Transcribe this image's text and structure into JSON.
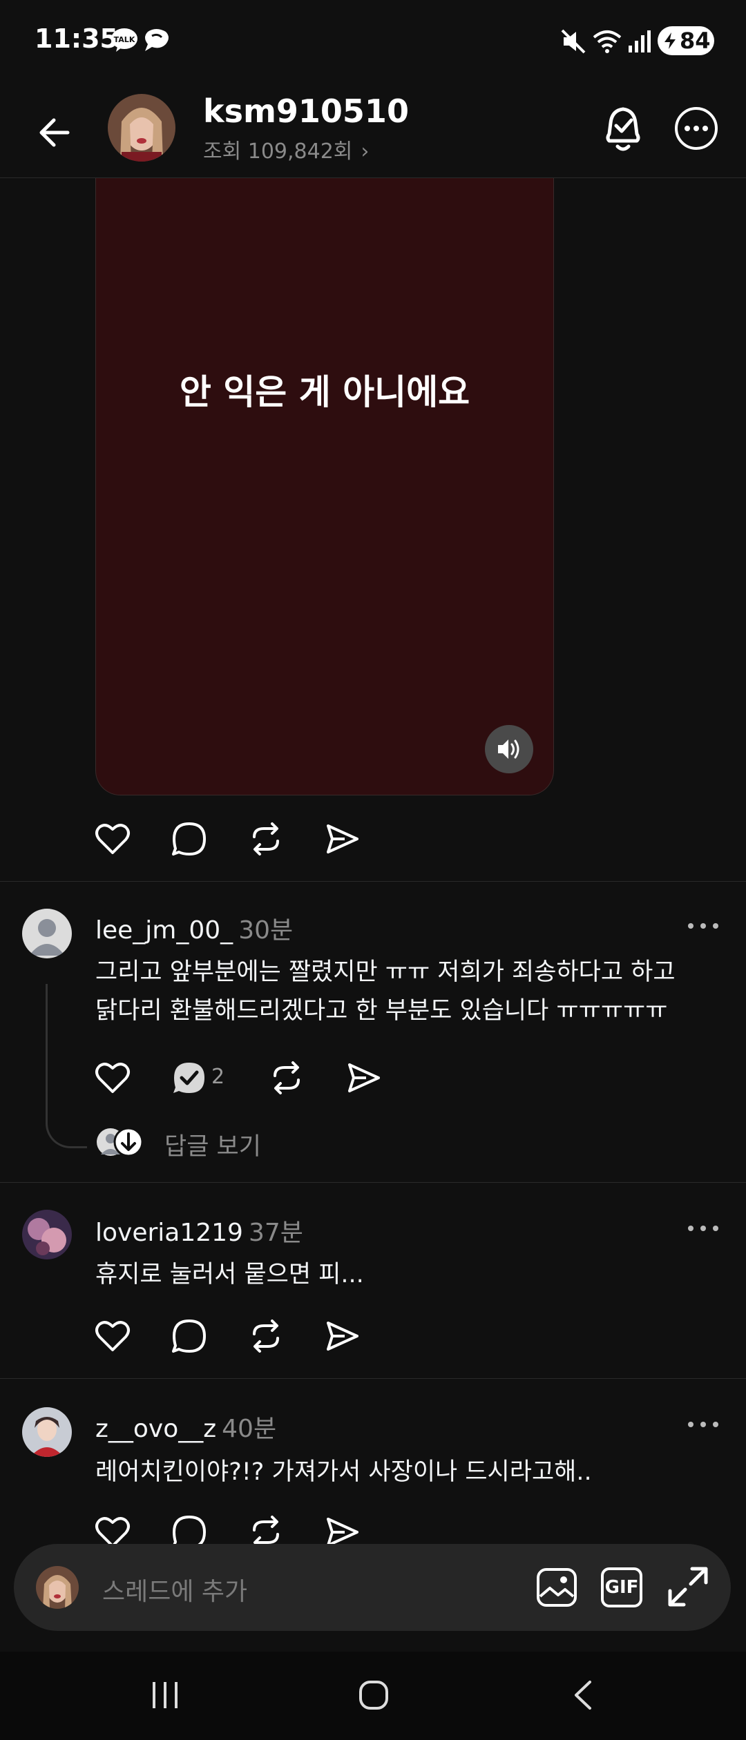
{
  "status_bar": {
    "time": "11:35",
    "battery": "84",
    "icons": [
      "talk-notification-icon",
      "chat-bubble-icon",
      "mute-icon",
      "wifi-icon",
      "signal-icon",
      "battery-icon"
    ]
  },
  "header": {
    "username": "ksm910510",
    "views": "조회 109,842회"
  },
  "post": {
    "video_caption": "안 익은 게 아니에요"
  },
  "comments": [
    {
      "username": "lee_jm_00_",
      "time": "30분",
      "text_line1": "그리고 앞부분에는 짤렸지만 ㅠㅠ 저희가 죄송하다고 하고",
      "text_line2": "닭다리 환불해드리겠다고 한 부분도 있습니다 ㅠㅠㅠㅠㅠ",
      "reply_count": "2",
      "view_replies": "답글 보기"
    },
    {
      "username": "loveria1219",
      "time": "37분",
      "text": "휴지로 눌러서  뭍으면 피..."
    },
    {
      "username": "z__ovo__z",
      "time": "40분",
      "text": "레어치킨이야?!? 가져가서 사장이나 드시라고해.."
    }
  ],
  "composer": {
    "placeholder": "스레드에 추가",
    "gif_label": "GIF"
  },
  "colors": {
    "background": "#101010",
    "video_bg": "#2e0d0f",
    "muted_text": "#8a8a8a"
  }
}
